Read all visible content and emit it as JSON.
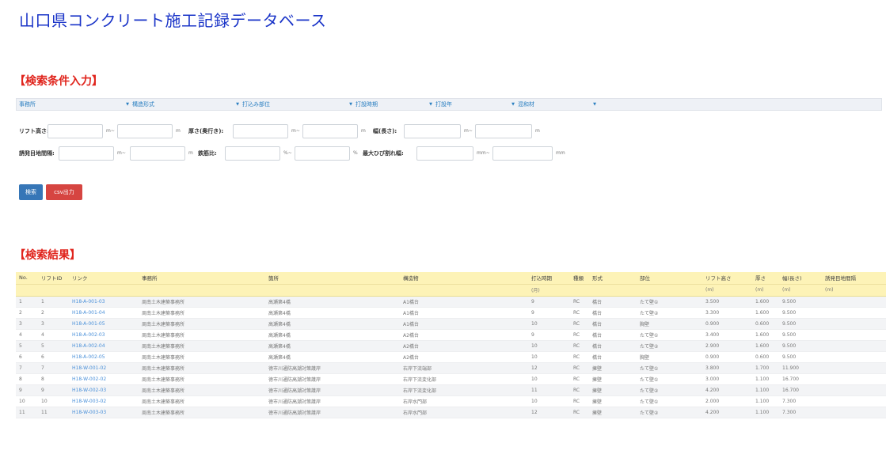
{
  "app_title": "山口県コンクリート施工記録データベース",
  "search_section_title": "【検索条件入力】",
  "results_section_title": "【検索結果】",
  "filters": [
    {
      "label": "事務所"
    },
    {
      "label": "構造形式"
    },
    {
      "label": "打込み部位"
    },
    {
      "label": "打設時期"
    },
    {
      "label": "打設年"
    },
    {
      "label": "混和材"
    }
  ],
  "range_row1": {
    "lift_label": "リフト高さ:",
    "lift_sep": "m~",
    "lift_unit": "m",
    "thick_label": "厚さ(奥行き):",
    "thick_sep": "m~",
    "thick_unit": "m",
    "width_label": "幅(長さ):",
    "width_sep": "m~",
    "width_unit": "m"
  },
  "range_row2": {
    "joint_label": "誘発目地間隔:",
    "joint_sep": "m~",
    "joint_unit": "m",
    "rebar_label": "鉄筋比:",
    "rebar_sep": "%~",
    "rebar_unit": "%",
    "crack_label": "最大ひび割れ幅:",
    "crack_sep": "mm~",
    "crack_unit": "mm"
  },
  "buttons": {
    "search": "検索",
    "csv": "csv出力"
  },
  "table": {
    "headers": [
      "No.",
      "リフトID",
      "リンク",
      "事務所",
      "箇所",
      "構造物",
      "打込時期",
      "種類",
      "形式",
      "部位",
      "リフト高さ",
      "厚さ",
      "幅(長さ)",
      "誘発目地間隔"
    ],
    "units": [
      "",
      "",
      "",
      "",
      "",
      "",
      "(月)",
      "",
      "",
      "",
      "(m)",
      "(m)",
      "(m)",
      "(m)"
    ],
    "rows": [
      [
        "1",
        "1",
        "H18-A-001-03",
        "周南土木建築事務所",
        "高瀬第4橋",
        "A1橋台",
        "9",
        "RC",
        "橋台",
        "たて壁①",
        "3.500",
        "1.600",
        "9.500",
        ""
      ],
      [
        "2",
        "2",
        "H18-A-001-04",
        "周南土木建築事務所",
        "高瀬第4橋",
        "A1橋台",
        "9",
        "RC",
        "橋台",
        "たて壁②",
        "3.300",
        "1.600",
        "9.500",
        ""
      ],
      [
        "3",
        "3",
        "H18-A-001-05",
        "周南土木建築事務所",
        "高瀬第4橋",
        "A1橋台",
        "10",
        "RC",
        "橋台",
        "胸壁",
        "0.900",
        "0.600",
        "9.500",
        ""
      ],
      [
        "4",
        "4",
        "H18-A-002-03",
        "周南土木建築事務所",
        "高瀬第4橋",
        "A2橋台",
        "9",
        "RC",
        "橋台",
        "たて壁①",
        "3.400",
        "1.600",
        "9.500",
        ""
      ],
      [
        "5",
        "5",
        "H18-A-002-04",
        "周南土木建築事務所",
        "高瀬第4橋",
        "A2橋台",
        "10",
        "RC",
        "橋台",
        "たて壁②",
        "2.900",
        "1.600",
        "9.500",
        ""
      ],
      [
        "6",
        "6",
        "H18-A-002-05",
        "周南土木建築事務所",
        "高瀬第4橋",
        "A2橋台",
        "10",
        "RC",
        "橋台",
        "胸壁",
        "0.900",
        "0.600",
        "9.500",
        ""
      ],
      [
        "7",
        "7",
        "H18-W-001-02",
        "周南土木建築事務所",
        "徳市川通防高潮対策護岸",
        "右岸下流端部",
        "12",
        "RC",
        "擁壁",
        "たて壁①",
        "3.800",
        "1.700",
        "11.900",
        ""
      ],
      [
        "8",
        "8",
        "H18-W-002-02",
        "周南土木建築事務所",
        "徳市川通防高潮対策護岸",
        "右岸下流変化部",
        "10",
        "RC",
        "擁壁",
        "たて壁①",
        "3.000",
        "1.100",
        "16.700",
        ""
      ],
      [
        "9",
        "9",
        "H18-W-002-03",
        "周南土木建築事務所",
        "徳市川通防高潮対策護岸",
        "右岸下流変化部",
        "11",
        "RC",
        "擁壁",
        "たて壁②",
        "4.200",
        "1.100",
        "16.700",
        ""
      ],
      [
        "10",
        "10",
        "H18-W-003-02",
        "周南土木建築事務所",
        "徳市川通防高潮対策護岸",
        "右岸水門部",
        "10",
        "RC",
        "擁壁",
        "たて壁①",
        "2.000",
        "1.100",
        "7.300",
        ""
      ],
      [
        "11",
        "11",
        "H18-W-003-03",
        "周南土木建築事務所",
        "徳市川通防高潮対策護岸",
        "右岸水門部",
        "12",
        "RC",
        "擁壁",
        "たて壁②",
        "4.200",
        "1.100",
        "7.300",
        ""
      ]
    ]
  }
}
